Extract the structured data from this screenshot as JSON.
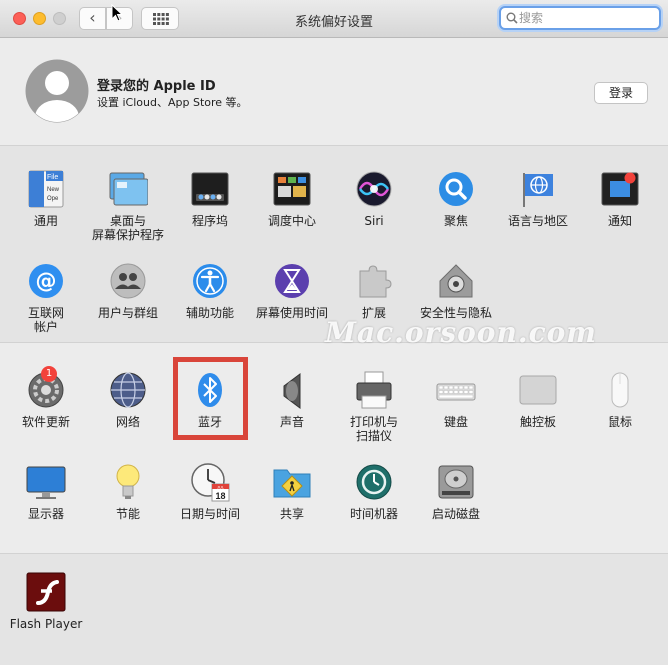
{
  "window": {
    "title": "系统偏好设置",
    "search_placeholder": "搜索"
  },
  "apple_id": {
    "title": "登录您的 Apple ID",
    "subtitle": "设置 iCloud、App Store 等。",
    "login_label": "登录"
  },
  "section1": [
    {
      "label": "通用",
      "icon": "general-icon"
    },
    {
      "label": "桌面与",
      "label2": "屏幕保护程序",
      "icon": "desktop-screensaver-icon"
    },
    {
      "label": "程序坞",
      "icon": "dock-icon"
    },
    {
      "label": "调度中心",
      "icon": "mission-control-icon"
    },
    {
      "label": "Siri",
      "icon": "siri-icon"
    },
    {
      "label": "聚焦",
      "icon": "spotlight-icon"
    },
    {
      "label": "语言与地区",
      "icon": "language-region-icon"
    },
    {
      "label": "通知",
      "icon": "notifications-icon"
    },
    {
      "label": "互联网",
      "label2": "帐户",
      "icon": "internet-accounts-icon"
    },
    {
      "label": "用户与群组",
      "icon": "users-groups-icon"
    },
    {
      "label": "辅助功能",
      "icon": "accessibility-icon"
    },
    {
      "label": "屏幕使用时间",
      "icon": "screen-time-icon"
    },
    {
      "label": "扩展",
      "icon": "extensions-icon"
    },
    {
      "label": "安全性与隐私",
      "icon": "security-privacy-icon"
    }
  ],
  "section2": [
    {
      "label": "软件更新",
      "icon": "software-update-icon",
      "badge": "1"
    },
    {
      "label": "网络",
      "icon": "network-icon"
    },
    {
      "label": "蓝牙",
      "icon": "bluetooth-icon"
    },
    {
      "label": "声音",
      "icon": "sound-icon"
    },
    {
      "label": "打印机与",
      "label2": "扫描仪",
      "icon": "printer-icon"
    },
    {
      "label": "键盘",
      "icon": "keyboard-icon"
    },
    {
      "label": "触控板",
      "icon": "trackpad-icon"
    },
    {
      "label": "鼠标",
      "icon": "mouse-icon"
    },
    {
      "label": "显示器",
      "icon": "displays-icon"
    },
    {
      "label": "节能",
      "icon": "energy-saver-icon"
    },
    {
      "label": "日期与时间",
      "icon": "date-time-icon"
    },
    {
      "label": "共享",
      "icon": "sharing-icon"
    },
    {
      "label": "时间机器",
      "icon": "time-machine-icon"
    },
    {
      "label": "启动磁盘",
      "icon": "startup-disk-icon"
    }
  ],
  "section3": [
    {
      "label": "Flash Player",
      "icon": "flash-player-icon"
    }
  ],
  "watermark": "Mac.orsoon.com",
  "icon_text": {
    "general": "File",
    "general_sub1": "New",
    "general_sub2": "Ope",
    "calendar_month": "JUL",
    "calendar_day": "18"
  },
  "colors": {
    "highlight": "#d9453a",
    "badge": "#f2423b",
    "search_focus": "#6aa0e8"
  }
}
